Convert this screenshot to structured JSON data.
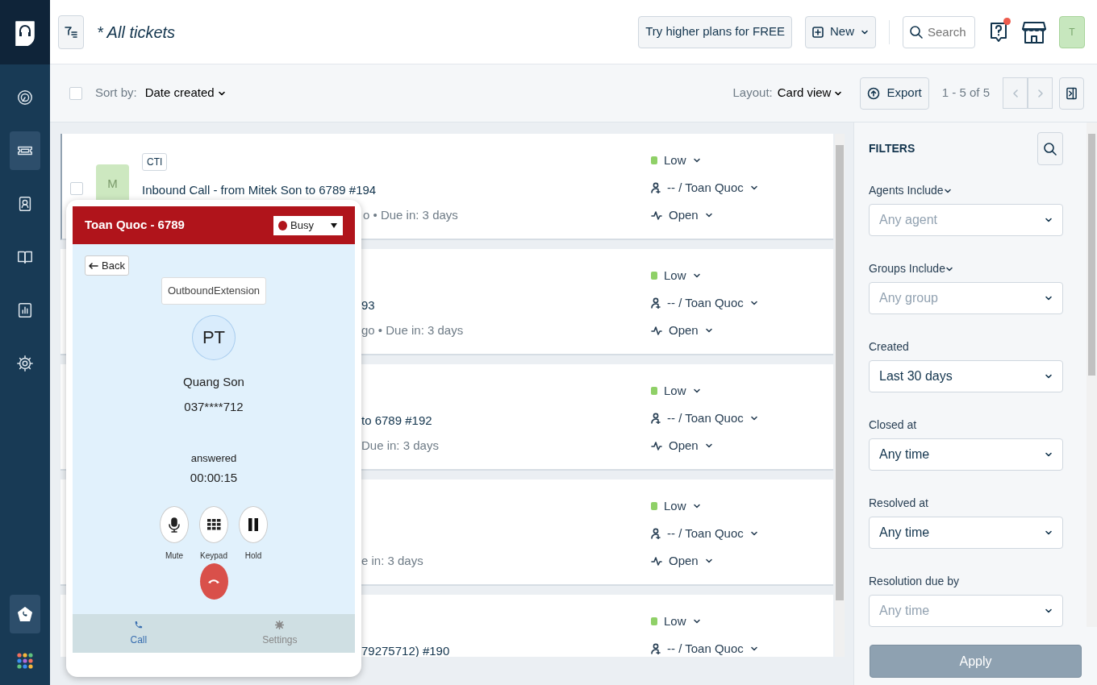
{
  "sidebar": {
    "items": [
      {
        "kind": "dashboard",
        "selected": false
      },
      {
        "kind": "tickets",
        "selected": true
      },
      {
        "kind": "contacts",
        "selected": false
      },
      {
        "kind": "book",
        "selected": false
      },
      {
        "kind": "reports",
        "selected": false
      },
      {
        "kind": "settings",
        "selected": false
      },
      {
        "kind": "phone",
        "selected": true
      },
      {
        "kind": "apps",
        "selected": false
      }
    ]
  },
  "header": {
    "title": "* All tickets",
    "upgrade_button": "Try higher plans for FREE",
    "new_button": "New",
    "search": {
      "placeholder": "Search"
    },
    "help_notification": true,
    "avatar": "T"
  },
  "toolbar": {
    "select_all_checked": false,
    "sort_label": "Sort by:",
    "sort_value": "Date created",
    "layout_label": "Layout:",
    "layout_value": "Card view",
    "export_button": "Export",
    "pagination": "1 - 5 of 5",
    "prev_disabled": true,
    "next_disabled": true
  },
  "tickets": [
    {
      "checked": false,
      "avatar": "M",
      "tag": "CTI",
      "subject": "Inbound Call - from Mitek Son to 6789 #194",
      "meta": "o • Due in: 3 days",
      "priority": "Low",
      "color": "#8fd067",
      "assignee": "-- / Toan Quoc",
      "status": "Open"
    },
    {
      "subject": "93",
      "meta": "go • Due in: 3 days",
      "priority": "Low",
      "color": "#8fd067",
      "assignee": "-- / Toan Quoc",
      "status": "Open"
    },
    {
      "subject": "to 6789 #192",
      "meta": "Due in: 3 days",
      "priority": "Low",
      "color": "#8fd067",
      "assignee": "-- / Toan Quoc",
      "status": "Open"
    },
    {
      "meta": "e in: 3 days",
      "priority": "Low",
      "color": "#8fd067",
      "assignee": "-- / Toan Quoc",
      "status": "Open"
    },
    {
      "subject": "79275712) #190",
      "priority": "Low",
      "color": "#8fd067",
      "assignee": "-- / Toan Quoc"
    }
  ],
  "filters": {
    "title": "FILTERS",
    "fields": [
      {
        "label": "Agents Include",
        "label_dropdown": true,
        "placeholder": "Any agent"
      },
      {
        "label": "Groups Include",
        "label_dropdown": true,
        "placeholder": "Any group"
      },
      {
        "label": "Created",
        "label_dropdown": false,
        "value": "Last 30 days"
      },
      {
        "label": "Closed at",
        "label_dropdown": false,
        "value": "Any time"
      },
      {
        "label": "Resolved at",
        "label_dropdown": false,
        "value": "Any time"
      },
      {
        "label": "Resolution due by",
        "label_dropdown": false,
        "placeholder": "Any time"
      }
    ],
    "apply_button": "Apply"
  },
  "phone": {
    "title": "Toan Quoc - 6789",
    "status": "Busy",
    "back_button": "Back",
    "extension": "OutboundExtension",
    "avatar": "PT",
    "caller_name": "Quang Son",
    "caller_number": "037****712",
    "call_state": "answered",
    "duration": "00:00:15",
    "controls": [
      {
        "kind": "mute",
        "label": "Mute"
      },
      {
        "kind": "keypad",
        "label": "Keypad"
      },
      {
        "kind": "hold",
        "label": "Hold"
      }
    ],
    "tabs": [
      {
        "kind": "call",
        "label": "Call",
        "selected": true
      },
      {
        "kind": "settings",
        "label": "Settings",
        "selected": false
      }
    ]
  }
}
